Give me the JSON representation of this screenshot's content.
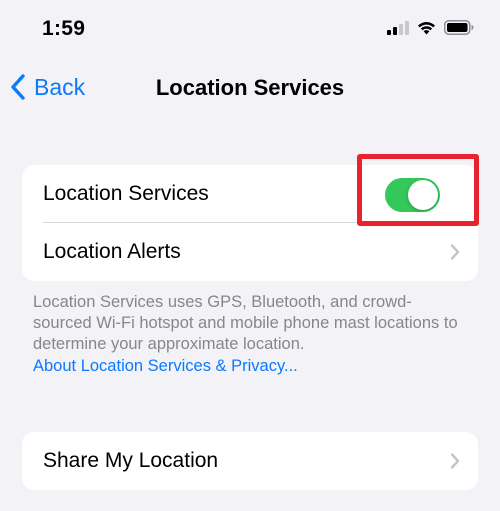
{
  "status_bar": {
    "time": "1:59",
    "icons": [
      "cellular-signal-icon",
      "wifi-icon",
      "battery-icon"
    ]
  },
  "nav": {
    "back_label": "Back",
    "title": "Location Services"
  },
  "group1": {
    "location_services_label": "Location Services",
    "location_services_enabled": true,
    "location_alerts_label": "Location Alerts"
  },
  "footer": {
    "description": "Location Services uses GPS, Bluetooth, and crowd-sourced Wi-Fi hotspot and mobile phone mast locations to determine your approximate location.",
    "link_label": "About Location Services & Privacy..."
  },
  "group2": {
    "share_my_location_label": "Share My Location"
  },
  "colors": {
    "accent": "#0a7aff",
    "toggle_on": "#34c759",
    "highlight": "#e8232f",
    "background": "#f2f2f7"
  }
}
